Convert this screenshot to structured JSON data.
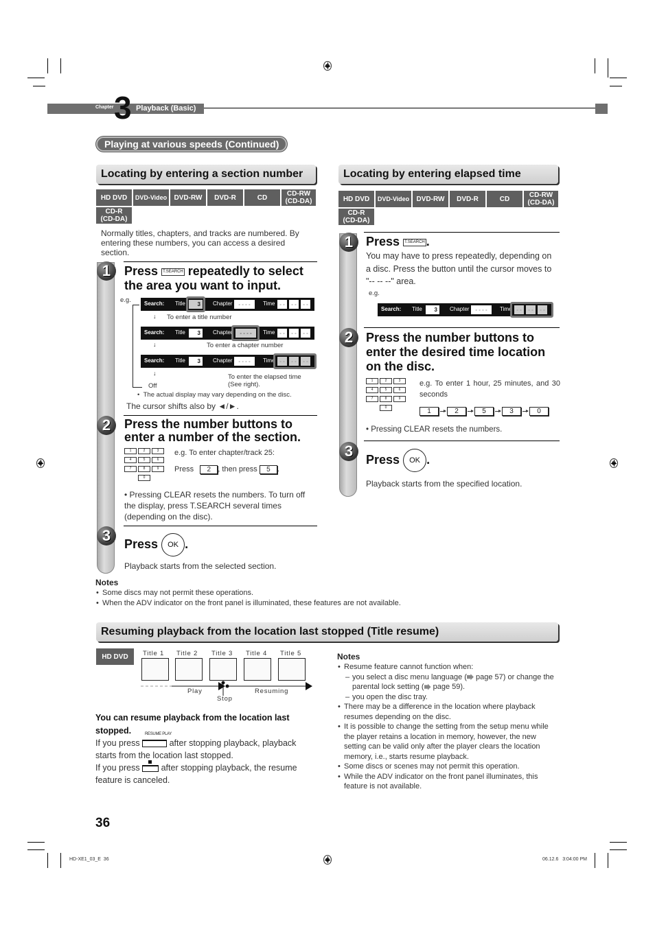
{
  "header": {
    "chapter_label": "Chapter",
    "chapter_number": "3",
    "chapter_title": "Playback (Basic)"
  },
  "banner": "Playing at various speeds (Continued)",
  "left_section": {
    "heading": "Locating by entering a section number",
    "discs": [
      "HD DVD",
      "DVD-Video",
      "DVD-RW",
      "DVD-R",
      "CD",
      "CD-RW\n(CD-DA)",
      "CD-R\n(CD-DA)"
    ],
    "intro": "Normally titles, chapters, and tracks are numbered. By entering these numbers, you can access a desired section.",
    "step1": {
      "num": "1",
      "title_pre": "Press",
      "button": "T.SEARCH",
      "title_post": "repeatedly to select the area you want to input.",
      "eg": "e.g.",
      "osd": {
        "search": "Search:",
        "title": "Title",
        "title_value": "3",
        "chapter": "Chapter",
        "chapter_value": "- - - -",
        "time": "Time",
        "time_value": "- -"
      },
      "caption_title": "To enter a title number",
      "caption_chapter": "To enter a chapter number",
      "caption_time": "To enter the elapsed time (See right).",
      "off": "Off",
      "display_note": "The actual display may vary depending on the disc.",
      "cursor_note": "The cursor shifts also by ◄/►."
    },
    "step2": {
      "num": "2",
      "title": "Press the number buttons to enter a number of the section.",
      "keys": [
        "1",
        "2",
        "3",
        "4",
        "5",
        "6",
        "7",
        "8",
        "9",
        "0"
      ],
      "eg": "e.g. To enter chapter/track 25:",
      "press": "Press",
      "key_a": "2",
      "then_press": ", then press",
      "key_b": "5",
      "note": "Pressing CLEAR resets the numbers. To turn off the display, press T.SEARCH several times (depending on the disc)."
    },
    "step3": {
      "num": "3",
      "press": "Press",
      "button": "OK",
      "desc": "Playback starts from the selected section."
    }
  },
  "right_section": {
    "heading": "Locating by entering elapsed time",
    "discs": [
      "HD DVD",
      "DVD-Video",
      "DVD-RW",
      "DVD-R",
      "CD",
      "CD-RW\n(CD-DA)",
      "CD-R\n(CD-DA)"
    ],
    "step1": {
      "num": "1",
      "press": "Press",
      "button": "T.SEARCH",
      "desc": "You may have to press repeatedly, depending on a disc. Press the button until the cursor moves to \"-- -- --\" area.",
      "eg": "e.g."
    },
    "step2": {
      "num": "2",
      "title": "Press the number buttons to enter the desired time location on the disc.",
      "eg": "e.g. To enter 1 hour, 25 minutes, and 30 seconds",
      "sequence": [
        "1",
        "2",
        "5",
        "3",
        "0"
      ],
      "note": "Pressing CLEAR resets the numbers."
    },
    "step3": {
      "num": "3",
      "press": "Press",
      "button": "OK",
      "desc": "Playback starts from the specified location."
    }
  },
  "notes1": {
    "heading": "Notes",
    "items": [
      "Some discs may not permit these operations.",
      "When the ADV indicator on the front panel is illuminated, these features are not available."
    ]
  },
  "resume": {
    "heading": "Resuming playback from the location last stopped (Title resume)",
    "disc": "HD DVD",
    "titles": [
      "Title 1",
      "Title 2",
      "Title 3",
      "Title 4",
      "Title 5"
    ],
    "play": "Play",
    "stop": "Stop",
    "resuming": "Resuming",
    "bold_lead": "You can resume playback from the location last stopped.",
    "resume_play_label": "RESUME PLAY",
    "line1_pre": "If you press",
    "line1_post": "after stopping playback, playback starts from the location last stopped.",
    "line2_pre": "If you press",
    "line2_post": "after stopping playback, the resume feature is canceled.",
    "notes_heading": "Notes",
    "notes": {
      "n1": "Resume feature cannot function when:",
      "n1a_pre": "you select a disc menu language (",
      "n1a_mid": " page 57) or change the parental lock setting (",
      "n1a_post": " page 59).",
      "n1b": "you open the disc tray.",
      "n2": "There may be a difference in the location where playback resumes depending on the disc.",
      "n3": "It is possible to change the setting from the setup menu while the player retains a location in memory, however, the new setting can be valid only after the player clears the location memory, i.e., starts resume playback.",
      "n4": "Some discs or scenes may not permit this operation.",
      "n5": "While the ADV indicator on the front panel illuminates, this feature is not available."
    }
  },
  "footer": {
    "page_number": "36",
    "file": "HD-XE1_03_E  36",
    "timestamp": "06.12.6   3:04:00 PM"
  }
}
